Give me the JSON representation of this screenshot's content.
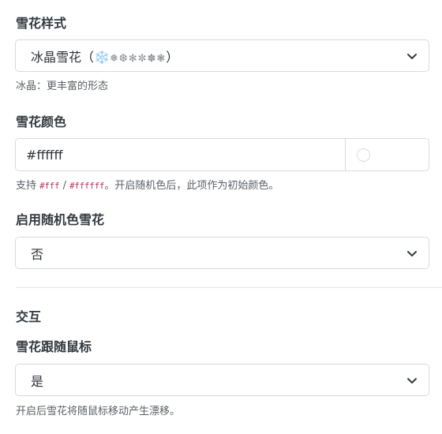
{
  "style_field": {
    "label": "雪花样式",
    "selected_text": "冰晶雪花（",
    "selected_icon": "❄️",
    "selected_glyphs": "❅❆✻✼✽❃",
    "selected_close": "）",
    "hint": "冰晶：更丰富的形态"
  },
  "color_field": {
    "label": "雪花颜色",
    "value": "#ffffff",
    "swatch_color": "#ffffff",
    "hint_prefix": "支持 ",
    "hint_code_short": "#fff",
    "hint_sep": " / ",
    "hint_code_long": "#ffffff",
    "hint_suffix": "。开启随机色后，此项作为初始颜色。"
  },
  "random_color_field": {
    "label": "启用随机色雪花",
    "selected": "否"
  },
  "interaction_section": {
    "title": "交互"
  },
  "follow_mouse_field": {
    "label": "雪花跟随鼠标",
    "selected": "是",
    "hint": "开启后雪花将随鼠标移动产生漂移。"
  },
  "icons": {
    "select_arrow": "chevron-down-icon"
  },
  "colors": {
    "border": "#d6dade",
    "label_text": "#333a40",
    "hint_text": "#5b6167",
    "code_text": "#c2255c"
  }
}
